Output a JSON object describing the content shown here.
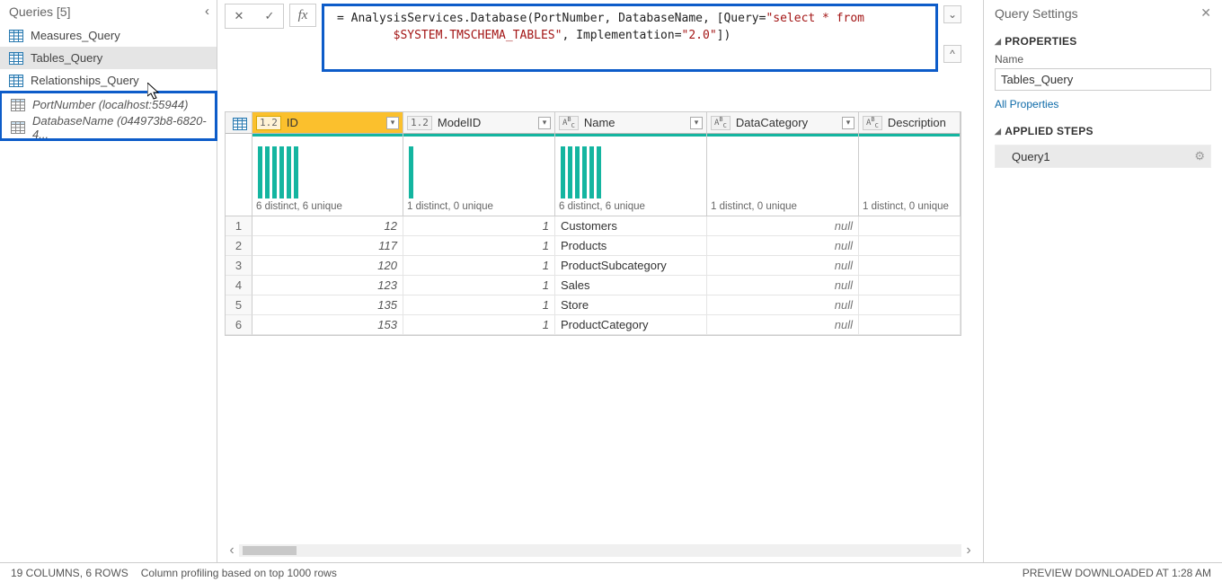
{
  "queries_panel": {
    "title": "Queries [5]",
    "items": [
      {
        "label": "Measures_Query",
        "type": "table",
        "selected": false,
        "param": false,
        "highlighted": false
      },
      {
        "label": "Tables_Query",
        "type": "table",
        "selected": true,
        "param": false,
        "highlighted": false
      },
      {
        "label": "Relationships_Query",
        "type": "table",
        "selected": false,
        "param": false,
        "highlighted": false
      },
      {
        "label": "PortNumber (localhost:55944)",
        "type": "param",
        "selected": false,
        "param": true,
        "highlighted": true
      },
      {
        "label": "DatabaseName (044973b8-6820-4...",
        "type": "param",
        "selected": false,
        "param": true,
        "highlighted": true
      }
    ]
  },
  "formula": {
    "prefix": "= AnalysisServices.Database(PortNumber, DatabaseName, [Query=",
    "str1": "\"select * from \n        $SYSTEM.TMSCHEMA_TABLES\"",
    "mid": ", Implementation=",
    "str2": "\"2.0\"",
    "suffix": "])"
  },
  "columns": [
    {
      "name": "ID",
      "dtype": "1.2",
      "dclass": "col-id",
      "distinct": "6 distinct, 6 unique",
      "bars": [
        58,
        58,
        58,
        58,
        58,
        58
      ],
      "first": true,
      "kind": "num"
    },
    {
      "name": "ModelID",
      "dtype": "1.2",
      "dclass": "col-model",
      "distinct": "1 distinct, 0 unique",
      "bars": [
        58
      ],
      "first": false,
      "kind": "num"
    },
    {
      "name": "Name",
      "dtype": "ABC",
      "dclass": "col-name",
      "distinct": "6 distinct, 6 unique",
      "bars": [
        58,
        58,
        58,
        58,
        58,
        58
      ],
      "first": false,
      "kind": "txt"
    },
    {
      "name": "DataCategory",
      "dtype": "ABC",
      "dclass": "col-cat",
      "distinct": "1 distinct, 0 unique",
      "bars": [],
      "first": false,
      "kind": "null"
    },
    {
      "name": "Description",
      "dtype": "ABC",
      "dclass": "col-desc",
      "distinct": "1 distinct, 0 unique",
      "bars": [],
      "first": false,
      "kind": "null",
      "nodrop": true
    }
  ],
  "rows": [
    {
      "idx": "1",
      "cells": [
        "12",
        "1",
        "Customers",
        "null",
        ""
      ]
    },
    {
      "idx": "2",
      "cells": [
        "117",
        "1",
        "Products",
        "null",
        ""
      ]
    },
    {
      "idx": "3",
      "cells": [
        "120",
        "1",
        "ProductSubcategory",
        "null",
        ""
      ]
    },
    {
      "idx": "4",
      "cells": [
        "123",
        "1",
        "Sales",
        "null",
        ""
      ]
    },
    {
      "idx": "5",
      "cells": [
        "135",
        "1",
        "Store",
        "null",
        ""
      ]
    },
    {
      "idx": "6",
      "cells": [
        "153",
        "1",
        "ProductCategory",
        "null",
        ""
      ]
    }
  ],
  "settings": {
    "title": "Query Settings",
    "properties_label": "PROPERTIES",
    "name_label": "Name",
    "name_value": "Tables_Query",
    "all_props": "All Properties",
    "steps_label": "APPLIED STEPS",
    "steps": [
      {
        "label": "Query1"
      }
    ]
  },
  "status": {
    "left1": "19 COLUMNS, 6 ROWS",
    "left2": "Column profiling based on top 1000 rows",
    "right": "PREVIEW DOWNLOADED AT 1:28 AM"
  }
}
